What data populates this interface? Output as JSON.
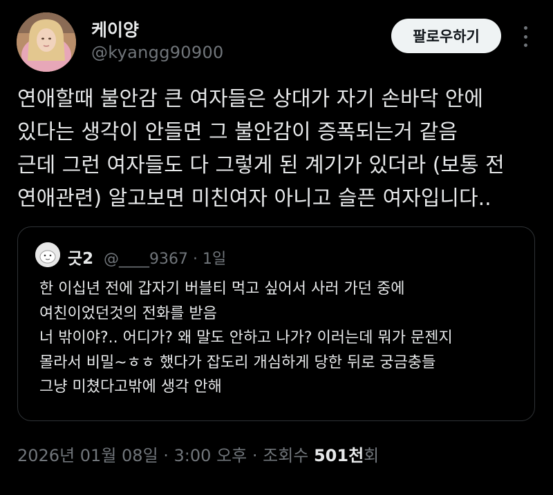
{
  "author": {
    "display_name": "케이양",
    "handle": "@kyangg90900"
  },
  "follow_label": "팔로우하기",
  "tweet_lines": [
    "연애할때 불안감 큰 여자들은 상대가 자기 손바닥 안에",
    "있다는 생각이 안들면 그 불안감이 증폭되는거 같음",
    "근데 그런 여자들도 다 그렇게 된 계기가 있더라 (보통 전",
    "연애관련) 알고보면 미친여자 아니고 슬픈 여자입니다.."
  ],
  "quote": {
    "display_name": "긋2",
    "handle_time": "@____9367 · 1일",
    "lines": [
      "한 이십년 전에 갑자기 버블티 먹고 싶어서 사러 가던 중에",
      "여친이었던것의 전화를 받음",
      "너 밖이야?.. 어디가? 왜 말도 안하고 나가? 이러는데 뭐가 문젠지",
      "몰라서 비밀~ㅎㅎ 했다가 잡도리 개심하게 당한 뒤로 궁금충들",
      "그냥 미쳤다고밖에 생각 안해"
    ]
  },
  "meta": {
    "datetime": "2026년 01월 08일 · 3:00 오후 · 조회수 ",
    "views_count": "501천",
    "views_suffix": "회"
  },
  "icons": {
    "more": "more-horizontal-icon"
  },
  "colors": {
    "background": "#000000",
    "text_primary": "#e7e9ea",
    "text_secondary": "#71767b",
    "border": "#2f3336",
    "follow_button_bg": "#eff3f4"
  }
}
